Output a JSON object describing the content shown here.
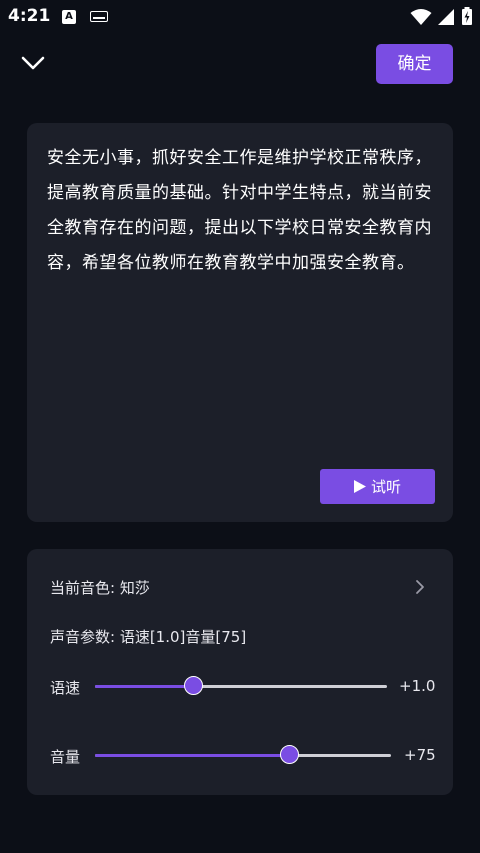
{
  "status_bar": {
    "time": "4:21",
    "notification_icons": [
      "a-letter-icon",
      "keyboard-icon"
    ],
    "system_icons": [
      "wifi-icon",
      "signal-icon",
      "battery-charging-icon"
    ]
  },
  "header": {
    "back_icon": "chevron-down-icon",
    "confirm_label": "确定"
  },
  "text_card": {
    "content": "安全无小事，抓好安全工作是维护学校正常秩序，提高教育质量的基础。针对中学生特点，就当前安全教育存在的问题，提出以下学校日常安全教育内容，希望各位教师在教育教学中加强安全教育。",
    "listen_label": "试听"
  },
  "voice_settings": {
    "current_voice": "当前音色: 知莎",
    "params": "声音参数: 语速[1.0]音量[75]",
    "sliders": [
      {
        "label": "语速",
        "value_text": "+1.0",
        "fraction": 0.34
      },
      {
        "label": "音量",
        "value_text": "+75",
        "fraction": 0.66
      }
    ]
  },
  "colors": {
    "background": "#0c0f17",
    "card": "#1c1f29",
    "accent": "#7a4de3",
    "text": "#ffffff"
  }
}
